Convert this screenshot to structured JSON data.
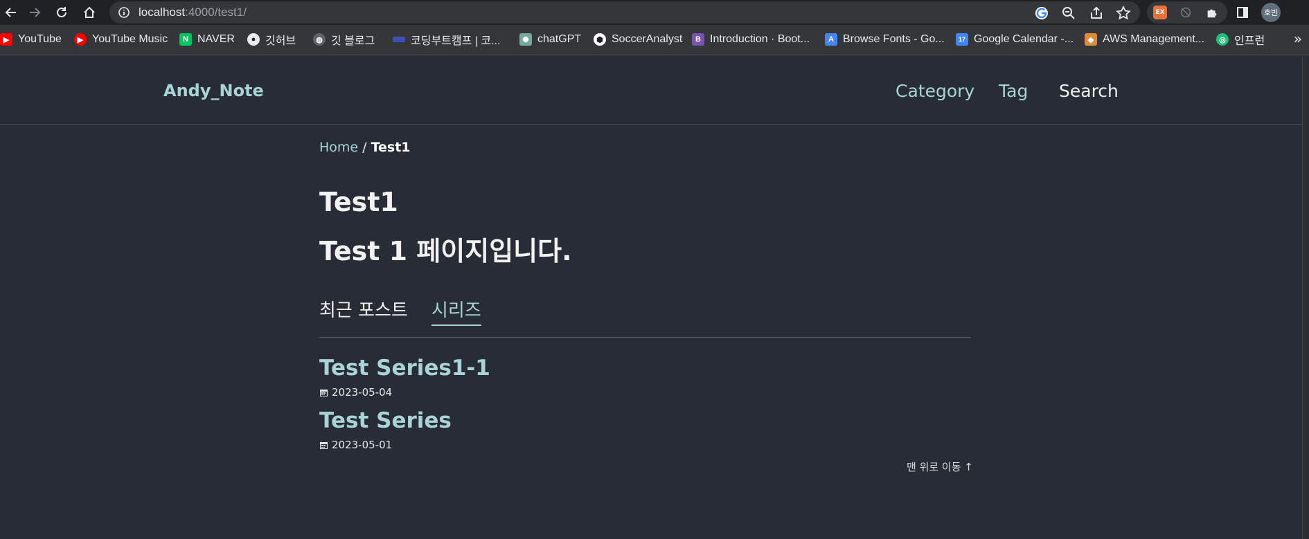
{
  "browser": {
    "url_host": "localhost",
    "url_path": ":4000/test1/",
    "profile_label": "호빈",
    "ext_label": "EX",
    "bookmarks": [
      {
        "label": "YouTube",
        "icon": "youtube-icon",
        "color": "#ff0000"
      },
      {
        "label": "YouTube Music",
        "icon": "youtube-music-icon",
        "color": "#ff0000"
      },
      {
        "label": "NAVER",
        "icon": "naver-icon",
        "color": "#03c75a",
        "letter": "N"
      },
      {
        "label": "깃허브",
        "icon": "github-icon",
        "color": "#e8eaed"
      },
      {
        "label": "깃 블로그",
        "icon": "globe-icon",
        "color": "#9aa0a6"
      },
      {
        "label": "코딩부트캠프 | 코...",
        "icon": "bootcamp-icon",
        "color": "#3f51b5"
      },
      {
        "label": "chatGPT",
        "icon": "chatgpt-icon",
        "color": "#74aa9c"
      },
      {
        "label": "SoccerAnalyst",
        "icon": "soccer-ball-icon",
        "color": "#ffffff"
      },
      {
        "label": "Introduction · Boot...",
        "icon": "bootstrap-icon",
        "color": "#7952b3",
        "letter": "B"
      },
      {
        "label": "Browse Fonts - Go...",
        "icon": "google-fonts-icon",
        "color": "#4285f4"
      },
      {
        "label": "Google Calendar -...",
        "icon": "calendar-icon",
        "color": "#4285f4",
        "letter": "17"
      },
      {
        "label": "AWS Management...",
        "icon": "aws-icon",
        "color": "#e08a3c"
      },
      {
        "label": "인프런",
        "icon": "inflearn-icon",
        "color": "#1dc078"
      }
    ],
    "more_bookmarks": "»"
  },
  "site": {
    "brand": "Andy_Note",
    "menu": [
      "Category",
      "Tag",
      "Search"
    ]
  },
  "breadcrumb": {
    "home": "Home",
    "separator": " / ",
    "current": "Test1"
  },
  "page": {
    "title": "Test1",
    "description": "Test 1 페이지입니다."
  },
  "tabs": {
    "recent": "최근 포스트",
    "series": "시리즈"
  },
  "posts": [
    {
      "title": "Test Series1-1",
      "date": "2023-05-04"
    },
    {
      "title": "Test Series",
      "date": "2023-05-01"
    }
  ],
  "back_to_top": "맨 위로 이동 ↑",
  "colors": {
    "background": "#282c36",
    "accent": "#a9d4d6"
  }
}
